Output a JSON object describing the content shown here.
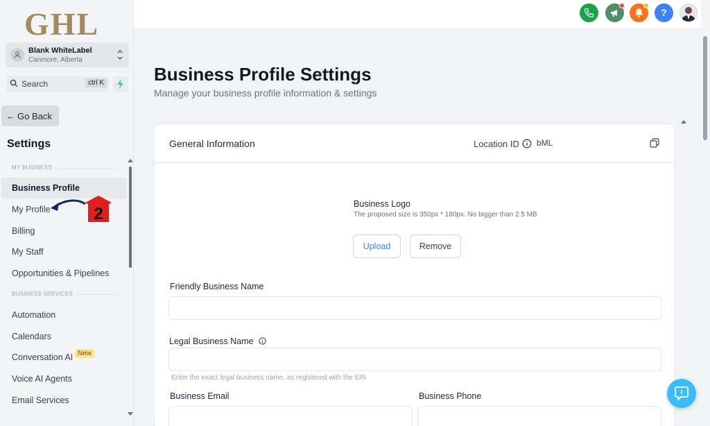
{
  "brand": {
    "logo_text": "GHL"
  },
  "location": {
    "name": "Blank WhiteLabel",
    "city": "Canmore, Alberta"
  },
  "search": {
    "label": "Search",
    "shortcut": "ctrl K"
  },
  "nav": {
    "go_back": "Go Back",
    "settings_title": "Settings",
    "section_my_business": "MY BUSINESS",
    "section_business_services": "BUSINESS SERVICES",
    "items": [
      {
        "label": "Business Profile"
      },
      {
        "label": "My Profile"
      },
      {
        "label": "Billing"
      },
      {
        "label": "My Staff"
      },
      {
        "label": "Opportunities & Pipelines"
      },
      {
        "label": "Automation"
      },
      {
        "label": "Calendars"
      },
      {
        "label": "Conversation AI",
        "badge": "New"
      },
      {
        "label": "Voice AI Agents"
      },
      {
        "label": "Email Services"
      }
    ]
  },
  "annotation": {
    "step_number": "2"
  },
  "topbar": {
    "icons": [
      "phone-icon",
      "megaphone-icon",
      "bell-icon",
      "help-icon"
    ],
    "help_symbol": "?",
    "colors": {
      "phone": "#16a34a",
      "megaphone": "#4f8f6b",
      "bell": "#f97316",
      "help": "#3b82f6"
    }
  },
  "page": {
    "title": "Business Profile Settings",
    "subtitle": "Manage your business profile information & settings"
  },
  "card": {
    "title": "General Information",
    "location_id_label": "Location ID",
    "location_id_value": "bML",
    "logo_title": "Business Logo",
    "logo_hint": "The proposed size is 350px * 180px. No bigger than 2.5 MB",
    "upload_label": "Upload",
    "remove_label": "Remove",
    "friendly_name_label": "Friendly Business Name",
    "friendly_name_value": "",
    "legal_name_label": "Legal Business Name",
    "legal_name_value": "",
    "legal_name_hint": "Enter the exact legal business name, as registered with the EIN",
    "email_label": "Business Email",
    "phone_label": "Business Phone"
  }
}
